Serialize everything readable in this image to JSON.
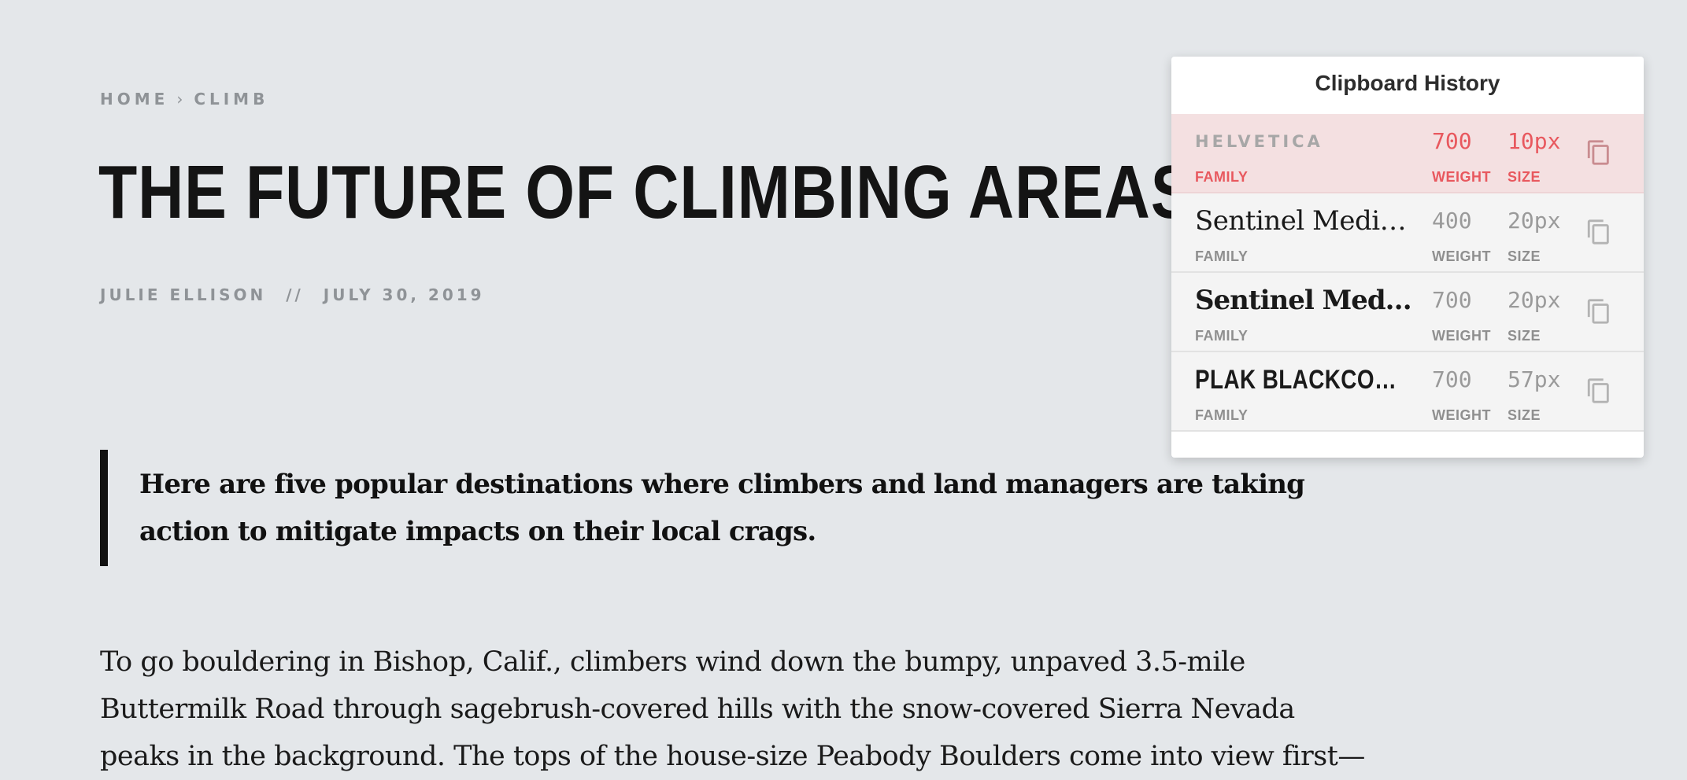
{
  "article": {
    "breadcrumb": {
      "home": "HOME",
      "separator": "›",
      "section": "CLIMB"
    },
    "title": "THE FUTURE OF CLIMBING AREAS",
    "byline": {
      "author": "JULIE ELLISON",
      "divider": "//",
      "date": "JULY 30, 2019"
    },
    "pullquote": "Here are five popular destinations where climbers and land managers are taking action to mitigate impacts on their local crags.",
    "body": "To go bouldering in Bishop, Calif., climbers wind down the bumpy, unpaved 3.5-mile Buttermilk Road through sagebrush-covered hills with the snow-covered Sierra Nevada peaks in the background. The tops of the house-size Peabody Boulders come into view first—"
  },
  "clipboard": {
    "title": "Clipboard History",
    "labels": {
      "family": "FAMILY",
      "weight": "WEIGHT",
      "size": "SIZE"
    },
    "accent_color": "#e8585e",
    "entries": [
      {
        "family": "HELVETICA",
        "weight": "700",
        "size": "10px",
        "active": true,
        "icon": "copy-icon"
      },
      {
        "family": "Sentinel Medium",
        "weight": "400",
        "size": "20px",
        "active": false,
        "icon": "copy-icon"
      },
      {
        "family": "Sentinel Medium",
        "weight": "700",
        "size": "20px",
        "active": false,
        "icon": "copy-icon"
      },
      {
        "family": "PLAK BLACKCONDENSED",
        "weight": "700",
        "size": "57px",
        "active": false,
        "icon": "copy-icon"
      }
    ]
  }
}
